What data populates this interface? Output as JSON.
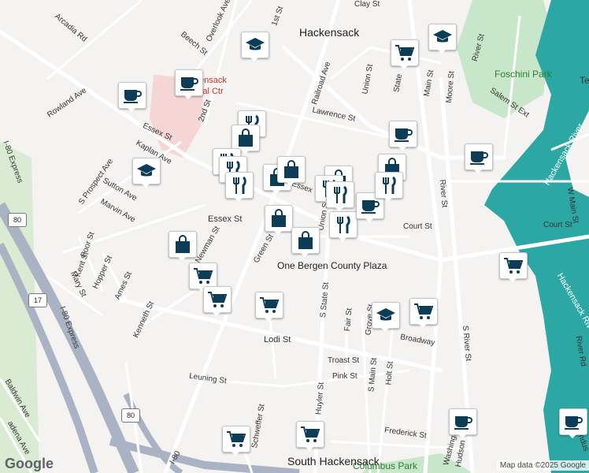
{
  "map": {
    "place_labels": {
      "hackensack": "Hackensack",
      "south_hackensack": "South\nHackensack",
      "medical_center": "Hackensack\nMedical Ctr",
      "bergen_plaza": "One Bergen County Plaza",
      "foschini_park": "Foschini Park",
      "columbus_park": "Columbus Park",
      "essex_station": "Essex St",
      "hackensack_river": "Hackensack River",
      "tea_partial": "Te"
    },
    "street_labels": {
      "arcadia_rd": "Arcadia Rd",
      "beech_st": "Beech St",
      "overlook_ave": "Overlook Ave",
      "first_st": "1st St",
      "railroad_ave": "Railroad Ave",
      "union_st": "Union St",
      "clay_st": "Clay St",
      "main_st": "Main St",
      "moore_st": "Moore St",
      "river_st_top": "River St",
      "salem_st_ext": "Salem St Ext",
      "rowland_ave": "Rowland Ave",
      "second_st": "2nd St",
      "lawrence_st": "Lawrence St",
      "state_st": "State",
      "essex_st_w": "Essex St",
      "kaplan_ave": "Kaplan Ave",
      "prospect_ave": "S Prospect Ave",
      "sutton_ave": "Sutton Ave",
      "marvin_ave": "Marvin Ave",
      "newman_st": "Newman St",
      "green_st": "Green St",
      "court_st": "Court St",
      "court_st_e": "Court St",
      "river_st_mid": "River St",
      "w_main_st": "W Main St",
      "poor_st": "Poor St",
      "kent_st": "Kent St",
      "hopper_st": "Hopper St",
      "mary_st": "Mary St",
      "ames_st": "Ames St",
      "kenneth_st": "Kenneth St",
      "i80_express": "I-80 Express",
      "i80_express_2": "I-80 Express",
      "s_state_st": "S State St",
      "fair_st": "Fair St",
      "grove_st": "Grove St",
      "broadway": "Broadway",
      "s_river_st": "S River St",
      "river_rd": "River Rd",
      "lodi_st": "Lodi St",
      "troast_st": "Troast St",
      "pink_st": "Pink St",
      "s_main_st": "S Main St",
      "holt_st": "Holt St",
      "leuning_st": "Leuning St",
      "huyler_st": "Huyler St",
      "schweffer_st": "Schweffer St",
      "frederick_st": "Frederick St",
      "washington_ave": "Washington Ave",
      "hudson": "Hudson",
      "baldwin_ave": "Baldwin Ave",
      "pasadena_ave": "adena Ave",
      "i80": "I-80",
      "indus": "Indus",
      "maple": "Ma",
      "union_st_low": "Union St",
      "essex_st_mid": "Essex"
    },
    "shields": {
      "r17": "17",
      "i80a": "80",
      "i80b": "80"
    },
    "colors": {
      "land": "#f4f3f1",
      "road": "#ffffff",
      "road_edge": "#dadce0",
      "highway": "#a9b3c4",
      "water": "#2ca7a4",
      "park": "#c8e6c9",
      "hospital": "#f6d5d5",
      "marker_icon": "#0d3d56"
    },
    "marker_types": [
      "coffee",
      "grocery",
      "school",
      "shopping",
      "restaurant"
    ],
    "markers": [
      {
        "type": "school",
        "icon": "graduation-cap-icon"
      },
      {
        "type": "grocery",
        "icon": "shopping-cart-icon"
      },
      {
        "type": "school",
        "icon": "graduation-cap-icon"
      },
      {
        "type": "coffee",
        "icon": "coffee-cup-icon"
      },
      {
        "type": "coffee",
        "icon": "coffee-cup-icon"
      },
      {
        "type": "restaurant",
        "icon": "fork-knife-icon"
      },
      {
        "type": "shopping",
        "icon": "shopping-bag-icon"
      },
      {
        "type": "coffee",
        "icon": "coffee-cup-icon"
      },
      {
        "type": "restaurant",
        "icon": "fork-knife-icon"
      },
      {
        "type": "restaurant",
        "icon": "fork-knife-icon"
      },
      {
        "type": "restaurant",
        "icon": "fork-knife-icon"
      },
      {
        "type": "shopping",
        "icon": "shopping-bag-icon"
      },
      {
        "type": "shopping",
        "icon": "shopping-bag-icon"
      },
      {
        "type": "school",
        "icon": "graduation-cap-icon"
      },
      {
        "type": "shopping",
        "icon": "shopping-bag-icon"
      },
      {
        "type": "shopping",
        "icon": "shopping-bag-icon"
      },
      {
        "type": "restaurant",
        "icon": "fork-knife-icon"
      },
      {
        "type": "restaurant",
        "icon": "fork-knife-icon"
      },
      {
        "type": "shopping",
        "icon": "shopping-bag-icon"
      },
      {
        "type": "restaurant",
        "icon": "fork-knife-icon"
      },
      {
        "type": "coffee",
        "icon": "coffee-cup-icon"
      },
      {
        "type": "coffee",
        "icon": "coffee-cup-icon"
      },
      {
        "type": "restaurant",
        "icon": "fork-knife-icon"
      },
      {
        "type": "shopping",
        "icon": "shopping-bag-icon"
      },
      {
        "type": "grocery",
        "icon": "shopping-cart-icon"
      },
      {
        "type": "grocery",
        "icon": "shopping-cart-icon"
      },
      {
        "type": "grocery",
        "icon": "shopping-cart-icon"
      },
      {
        "type": "grocery",
        "icon": "shopping-cart-icon"
      },
      {
        "type": "shopping",
        "icon": "shopping-bag-icon"
      },
      {
        "type": "school",
        "icon": "graduation-cap-icon"
      },
      {
        "type": "grocery",
        "icon": "shopping-cart-icon"
      },
      {
        "type": "coffee",
        "icon": "coffee-cup-icon"
      },
      {
        "type": "coffee",
        "icon": "coffee-cup-icon"
      },
      {
        "type": "grocery",
        "icon": "shopping-cart-icon"
      },
      {
        "type": "grocery",
        "icon": "shopping-cart-icon"
      }
    ]
  },
  "footer": {
    "logo": "Google",
    "attribution": "Map data ©2025 Google"
  }
}
